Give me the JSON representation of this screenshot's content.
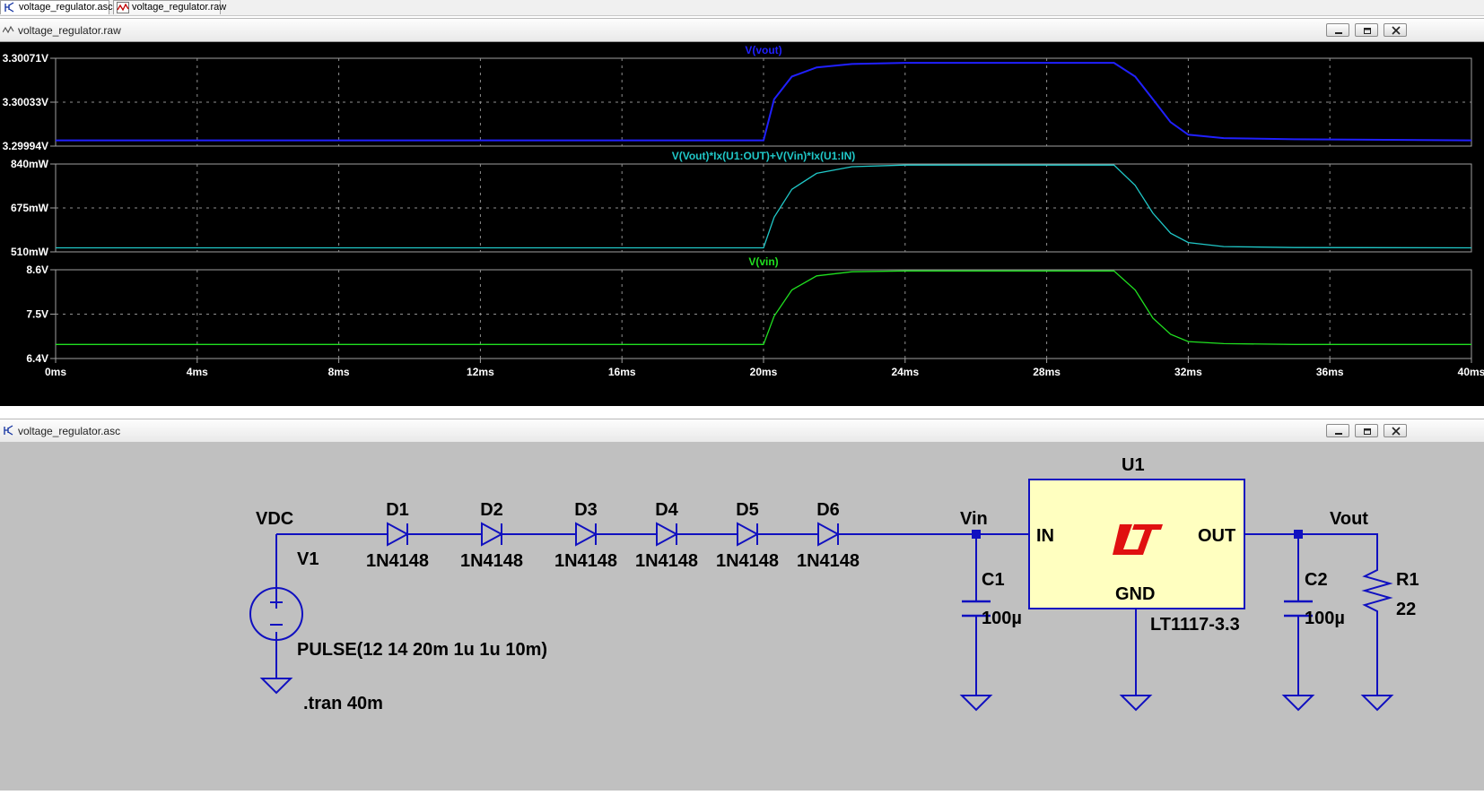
{
  "tabs": [
    {
      "label": "voltage_regulator.asc",
      "icon": "schematic-icon"
    },
    {
      "label": "voltage_regulator.raw",
      "icon": "waveform-icon"
    }
  ],
  "plot_window": {
    "title": "voltage_regulator.raw"
  },
  "schematic_window": {
    "title": "voltage_regulator.asc"
  },
  "colors": {
    "vout": "#2020ff",
    "power": "#20c8c8",
    "vin": "#20e020",
    "wire": "#1010c0",
    "regulator_body": "#ffffc0",
    "logo": "#e01010"
  },
  "chart_data": [
    {
      "type": "line",
      "title": "V(vout)",
      "yticks": [
        "3.30071V",
        "3.30033V",
        "3.29994V"
      ],
      "ylim": [
        3.29994,
        3.30071
      ],
      "xlim": [
        0,
        40
      ],
      "x": [
        0,
        20,
        20.3,
        20.8,
        21.5,
        22.5,
        24,
        27,
        29.9,
        30.5,
        31,
        31.5,
        32,
        33,
        35,
        40
      ],
      "values": [
        3.29999,
        3.29999,
        3.30035,
        3.30055,
        3.30063,
        3.30066,
        3.30067,
        3.30067,
        3.30067,
        3.30055,
        3.30035,
        3.30015,
        3.30004,
        3.30001,
        3.3,
        3.29999
      ]
    },
    {
      "type": "line",
      "title": "V(Vout)*Ix(U1:OUT)+V(Vin)*Ix(U1:IN)",
      "yticks": [
        "840mW",
        "675mW",
        "510mW"
      ],
      "ylim": [
        510,
        840
      ],
      "xlim": [
        0,
        40
      ],
      "x": [
        0,
        20,
        20.3,
        20.8,
        21.5,
        22.5,
        24,
        27,
        29.9,
        30.5,
        31,
        31.5,
        32,
        33,
        35,
        40
      ],
      "values": [
        525,
        525,
        640,
        745,
        805,
        830,
        836,
        836,
        836,
        760,
        655,
        580,
        545,
        530,
        526,
        525
      ]
    },
    {
      "type": "line",
      "title": "V(vin)",
      "yticks": [
        "8.6V",
        "7.5V",
        "6.4V"
      ],
      "ylim": [
        6.4,
        8.6
      ],
      "xlim": [
        0,
        40
      ],
      "x": [
        0,
        20,
        20.3,
        20.8,
        21.5,
        22.5,
        24,
        27,
        29.9,
        30.5,
        31,
        31.5,
        32,
        33,
        35,
        40
      ],
      "values": [
        6.75,
        6.75,
        7.45,
        8.1,
        8.45,
        8.55,
        8.57,
        8.57,
        8.57,
        8.1,
        7.4,
        7.0,
        6.82,
        6.77,
        6.75,
        6.75
      ]
    }
  ],
  "x_axis": {
    "ticks": [
      "0ms",
      "4ms",
      "8ms",
      "12ms",
      "16ms",
      "20ms",
      "24ms",
      "28ms",
      "32ms",
      "36ms",
      "40ms"
    ]
  },
  "schematic": {
    "vdc_label": "VDC",
    "vin_label": "Vin",
    "vout_label": "Vout",
    "diodes": [
      {
        "ref": "D1",
        "part": "1N4148"
      },
      {
        "ref": "D2",
        "part": "1N4148"
      },
      {
        "ref": "D3",
        "part": "1N4148"
      },
      {
        "ref": "D4",
        "part": "1N4148"
      },
      {
        "ref": "D5",
        "part": "1N4148"
      },
      {
        "ref": "D6",
        "part": "1N4148"
      }
    ],
    "source": {
      "ref": "V1",
      "value": "PULSE(12 14 20m 1u 1u 10m)"
    },
    "directive": ".tran 40m",
    "c1": {
      "ref": "C1",
      "value": "100µ"
    },
    "c2": {
      "ref": "C2",
      "value": "100µ"
    },
    "r1": {
      "ref": "R1",
      "value": "22"
    },
    "u1": {
      "ref": "U1",
      "part": "LT1117-3.3",
      "pin_in": "IN",
      "pin_out": "OUT",
      "pin_gnd": "GND"
    }
  }
}
